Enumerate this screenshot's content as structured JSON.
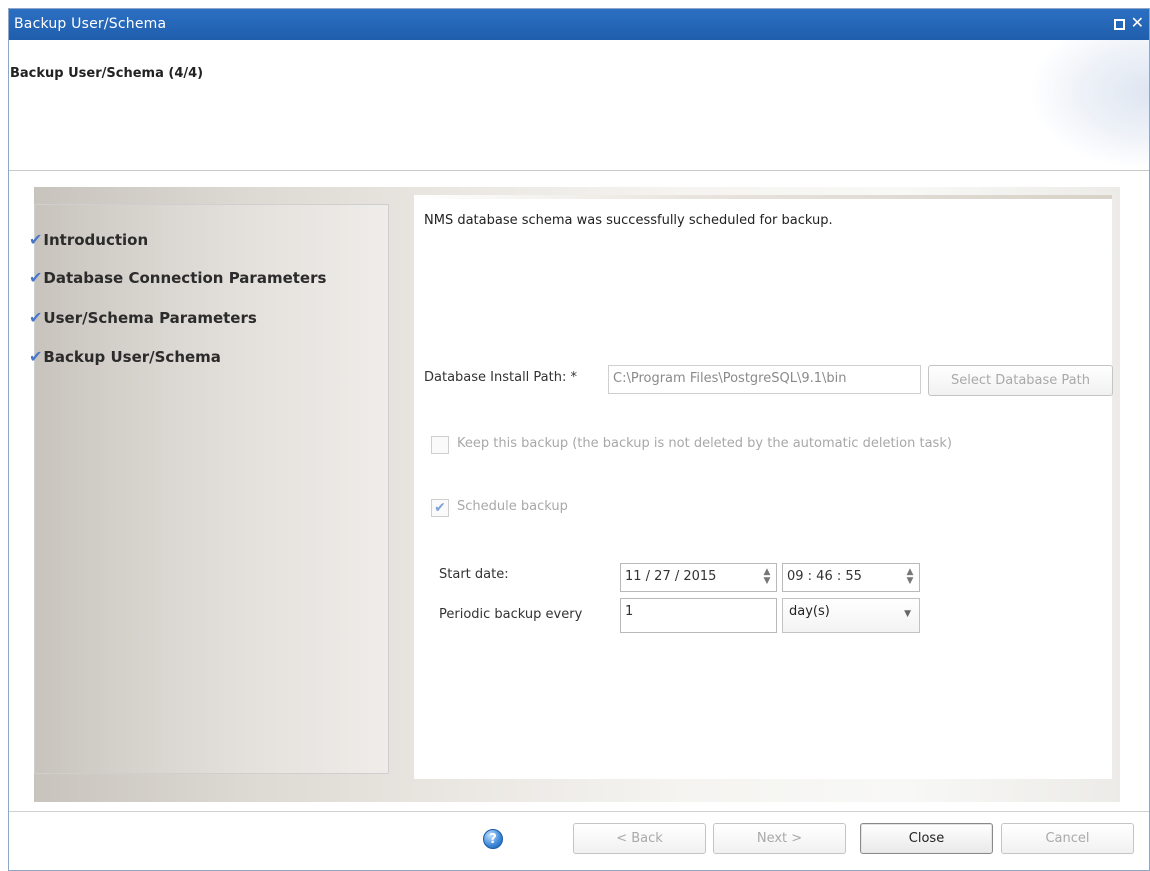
{
  "window": {
    "title": "Backup User/Schema",
    "controls": {
      "maximize": "□",
      "close": "✕"
    }
  },
  "header": {
    "step_title": "Backup User/Schema (4/4)"
  },
  "nav": {
    "items": [
      {
        "label": "Introduction",
        "icon": "check-icon"
      },
      {
        "label": "Database Connection Parameters",
        "icon": "check-icon"
      },
      {
        "label": "User/Schema Parameters",
        "icon": "check-icon"
      },
      {
        "label": "Backup User/Schema",
        "icon": "check-icon"
      }
    ],
    "check_glyph": "✔"
  },
  "main": {
    "message": "NMS database schema was successfully scheduled for backup.",
    "install_path": {
      "label": "Database Install Path: *",
      "value": "C:\\Program Files\\PostgreSQL\\9.1\\bin",
      "button": "Select Database Path"
    },
    "keep_backup": {
      "label": "Keep this backup (the backup is not deleted by the automatic deletion task)",
      "checked": false
    },
    "schedule_backup": {
      "label": "Schedule backup",
      "checked": true,
      "check_glyph": "✔"
    },
    "start_date": {
      "label": "Start date:",
      "date": "11 / 27 / 2015",
      "time": "09 : 46 : 55",
      "spinner": "▲▼"
    },
    "periodic": {
      "label": "Periodic backup every",
      "value": "1",
      "unit": "day(s)",
      "arrow": "▼"
    }
  },
  "footer": {
    "help": "?",
    "back": "< Back",
    "next": "Next >",
    "close": "Close",
    "cancel": "Cancel"
  },
  "colors": {
    "titlebar": "#2566b8",
    "check": "#4a77c9"
  }
}
